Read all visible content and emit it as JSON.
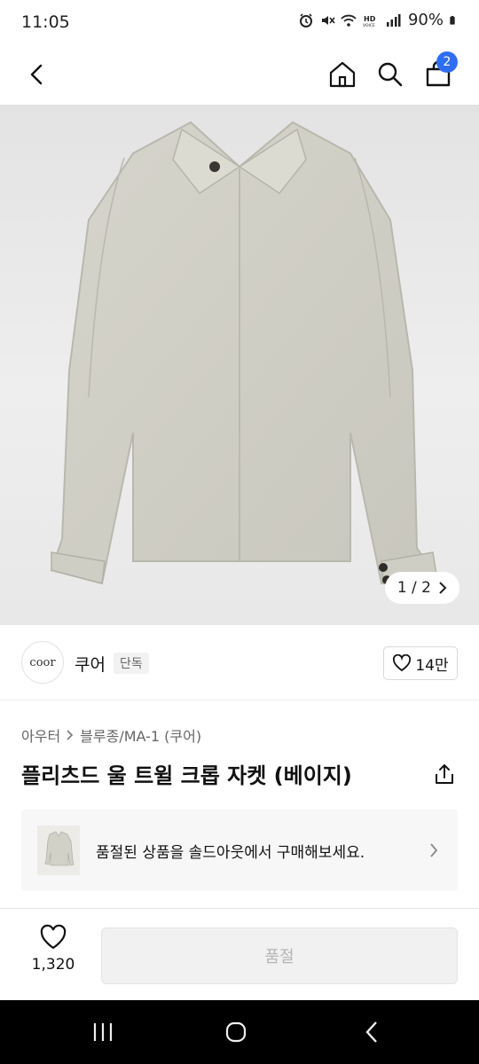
{
  "status_bar": {
    "time": "11:05",
    "battery": "90%",
    "icons": [
      "alarm-icon",
      "mute-icon",
      "wifi-icon",
      "hd-voice-icon",
      "signal-icon",
      "battery-icon"
    ]
  },
  "nav": {
    "icons": [
      "back-arrow-icon",
      "home-icon",
      "search-icon",
      "shopping-bag-icon"
    ],
    "cart_count": "2",
    "accent_color": "#2f6ef2"
  },
  "gallery": {
    "counter": "1 / 2"
  },
  "brand": {
    "logo_text": "coor",
    "name": "쿠어",
    "tag": "단독",
    "likes": "14만"
  },
  "product": {
    "category_main": "아우터",
    "category_sub": "블루종/MA-1 (쿠어)",
    "title": "플리츠드 울 트윌 크롭 자켓 (베이지)"
  },
  "soldout_banner": {
    "message": "품절된 상품을 솔드아웃에서 구매해보세요."
  },
  "bottom_bar": {
    "wish_count": "1,320",
    "status_button": "품절"
  }
}
